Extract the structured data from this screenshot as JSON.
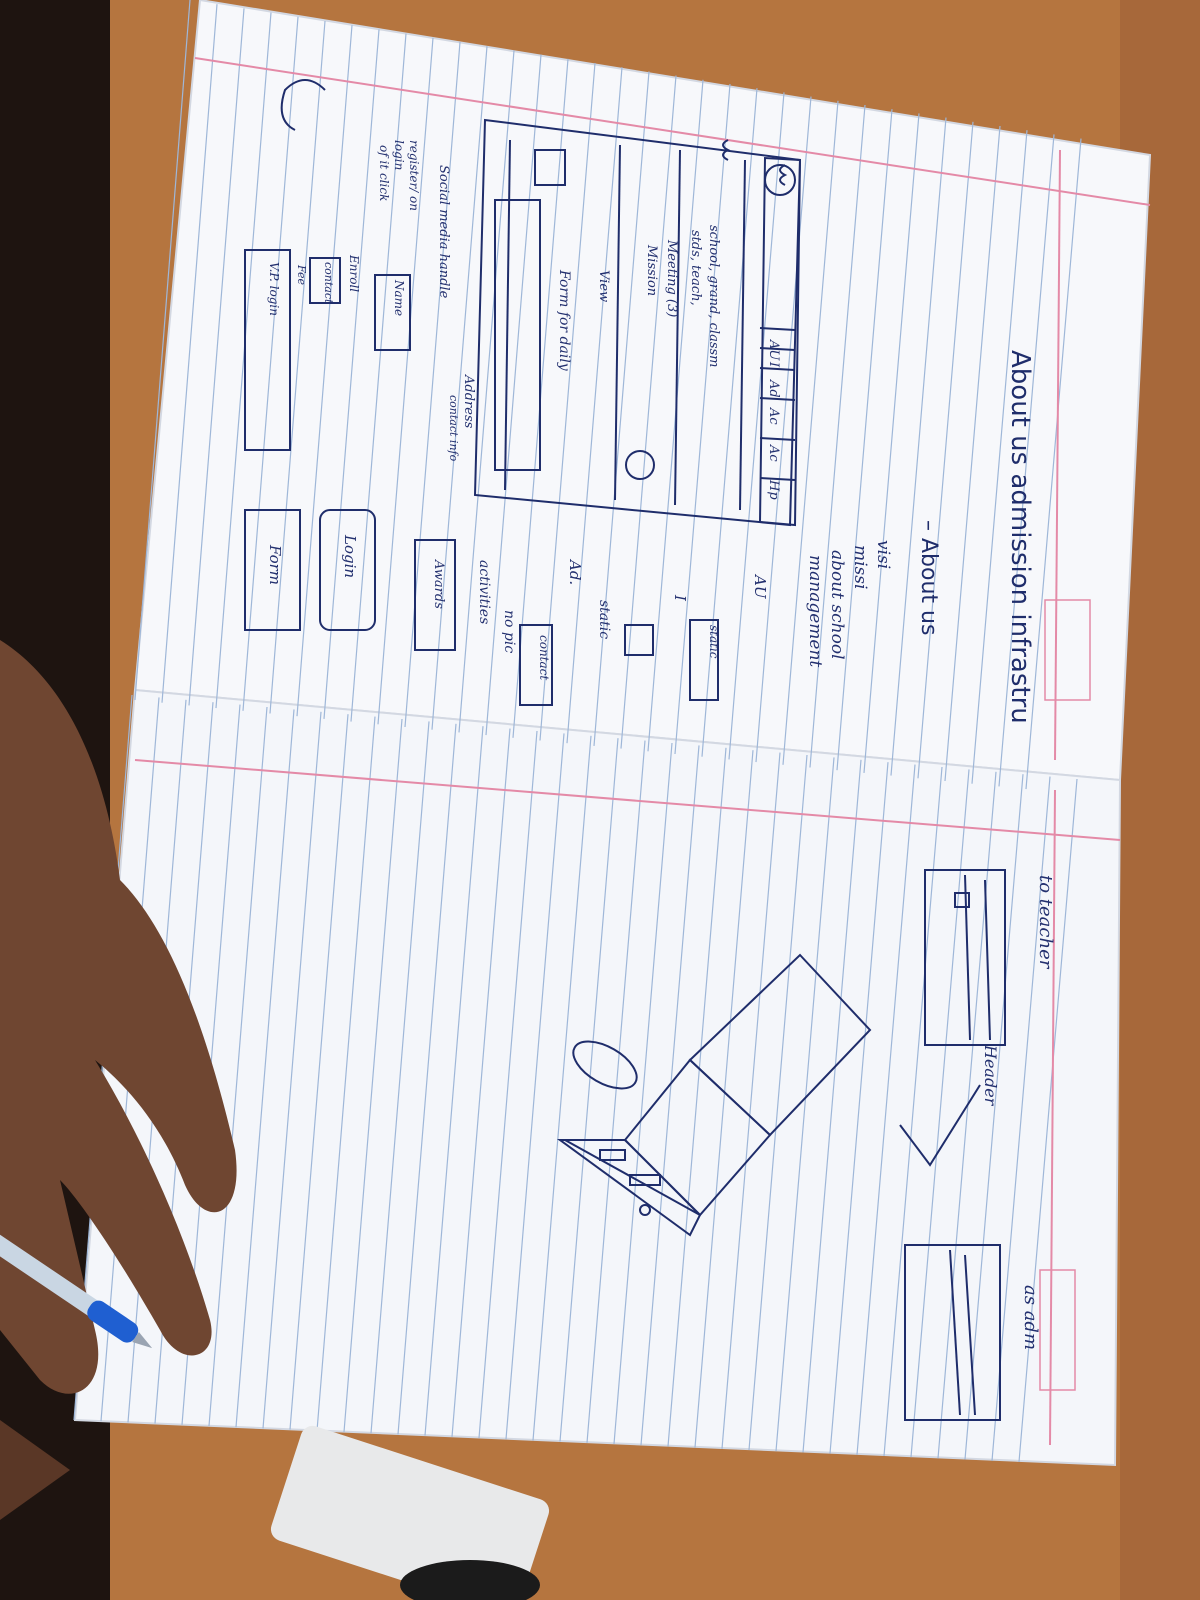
{
  "photo": {
    "subject": "notebook-sketch",
    "colors": {
      "desk": "#b5753f",
      "paper": "#f7f8fb",
      "ruled_line": "#9fb7d8",
      "margin_line": "#e48aa7",
      "ink": "#1f2d6b",
      "skin": "#6f4631",
      "pen_blue": "#1f5fd1"
    }
  },
  "notes": {
    "heading": "About us  admission  infrastru",
    "about_heading": "– About us",
    "about_items": [
      "visi",
      "missi",
      "about school",
      "management"
    ],
    "left_labels": {
      "nav_tabs": [
        "AU",
        "I",
        "Ad",
        "Ac",
        "Ac",
        "Hp"
      ],
      "school_text": "school, grand, classm",
      "school_text_2": "stds, teach,",
      "meeting": "Meeting (3)",
      "mission": "Mission",
      "view": "View",
      "form_for_daily": "Form for daily",
      "address": "Address",
      "contact_info": "contact info",
      "social_media": "Social media handle",
      "register": "register/ on",
      "login": "login",
      "login_2": "of it click",
      "name": "Name",
      "enroll": "Enroll",
      "contact": "contact",
      "fee": "Fee",
      "vp_login": "V.P. login"
    },
    "right_labels": {
      "au": "AU",
      "static": "static",
      "roman_one": "I",
      "static_2": "static",
      "ad": "Ad.",
      "contact": "contact",
      "no_pic": "no pic",
      "activities": "activities",
      "awards": "Awards",
      "login": "Login",
      "form": "Form"
    },
    "right_page": {
      "teacher": "to teacher",
      "header": "Header",
      "admin": "as adm"
    }
  }
}
